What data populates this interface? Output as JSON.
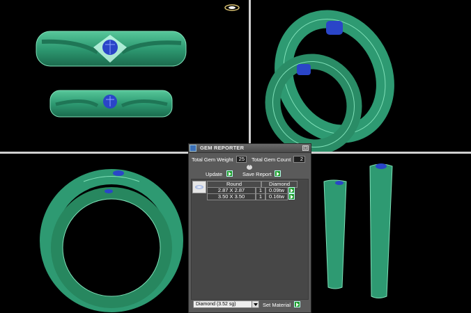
{
  "panel": {
    "title": "GEM REPORTER",
    "total_gem_weight_label": "Total Gem Weight",
    "total_gem_weight_value": "25",
    "total_gem_count_label": "Total Gem Count",
    "total_gem_count_value": "2",
    "update_label": "Update",
    "save_report_label": "Save Report",
    "columns": [
      "Round",
      "Diamond"
    ],
    "rows": [
      {
        "size": "2.87 X 2.87",
        "count": "1",
        "weight": "0.09tw"
      },
      {
        "size": "3.50 X 3.50",
        "count": "1",
        "weight": "0.16tw"
      }
    ],
    "material_selected": "Diamond    (3.52 sg)",
    "set_material_label": "Set Material"
  },
  "colors": {
    "ring": "#2e9a72",
    "gem": "#2a45c8",
    "background": "#000000",
    "panel": "#5a5a5a"
  },
  "icons": {
    "titlebar": "gem-reporter-icon",
    "close": "close-icon",
    "action": "green-arrow-icon"
  }
}
